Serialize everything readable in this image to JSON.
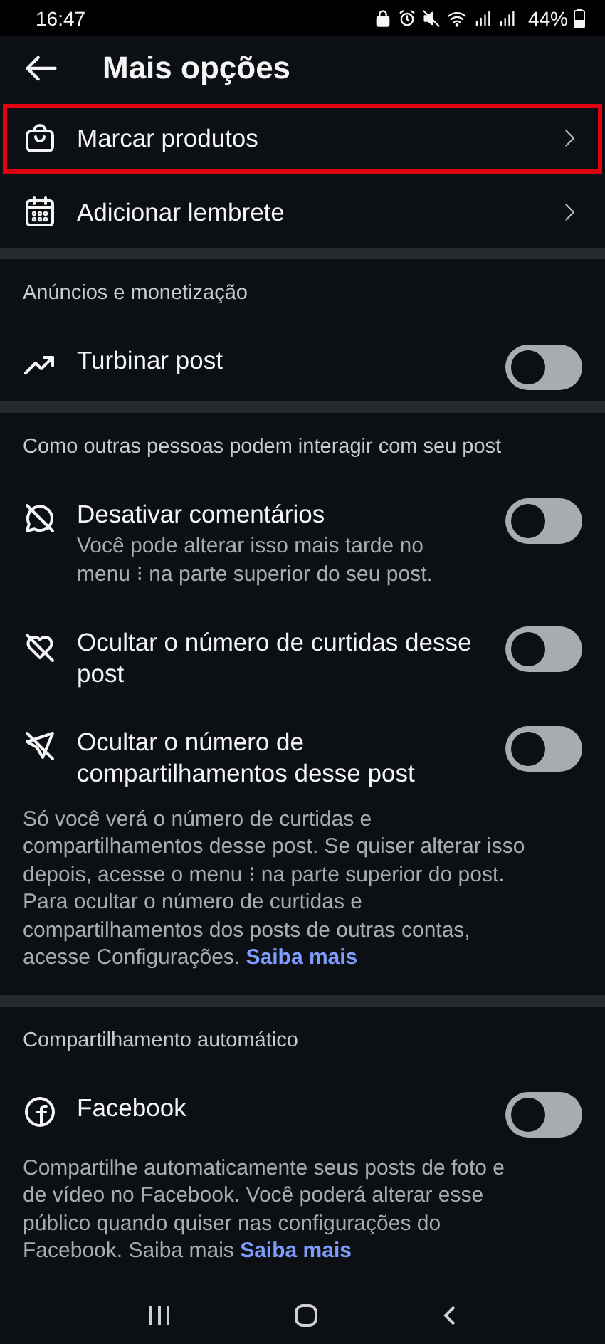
{
  "status_bar": {
    "time": "16:47",
    "battery": "44%"
  },
  "header": {
    "title": "Mais opções"
  },
  "sections": [
    {
      "items": [
        {
          "kind": "link",
          "label": "Marcar produtos",
          "highlighted": true
        },
        {
          "kind": "link",
          "label": "Adicionar lembrete",
          "highlighted": false
        }
      ]
    },
    {
      "heading": "Anúncios e monetização",
      "items": [
        {
          "kind": "toggle",
          "label": "Turbinar post",
          "on": false
        }
      ]
    },
    {
      "heading": "Como outras pessoas podem interagir com seu post",
      "items": [
        {
          "kind": "toggle",
          "label": "Desativar comentários",
          "description": "Você pode alterar isso mais tarde no menu ⁝ na parte superior do seu post.",
          "on": false
        },
        {
          "kind": "toggle",
          "label": "Ocultar o número de curtidas desse post",
          "on": false
        },
        {
          "kind": "toggle",
          "label": "Ocultar o número de compartilhamentos desse post",
          "on": false,
          "note": "Só você verá o número de curtidas e compartilhamentos desse post. Se quiser alterar isso depois, acesse o menu ⁝ na parte superior do post. Para ocultar o número de curtidas e compartilhamentos dos posts de outras contas, acesse Configurações.",
          "note_link": "Saiba mais"
        }
      ]
    },
    {
      "heading": "Compartilhamento automático",
      "items": [
        {
          "kind": "toggle",
          "label": "Facebook",
          "on": false,
          "note": "Compartilhe automaticamente seus posts de foto e de vídeo no Facebook. Você poderá alterar esse público quando quiser nas configurações do Facebook. Saiba mais",
          "note_link": "Saiba mais"
        }
      ]
    }
  ]
}
